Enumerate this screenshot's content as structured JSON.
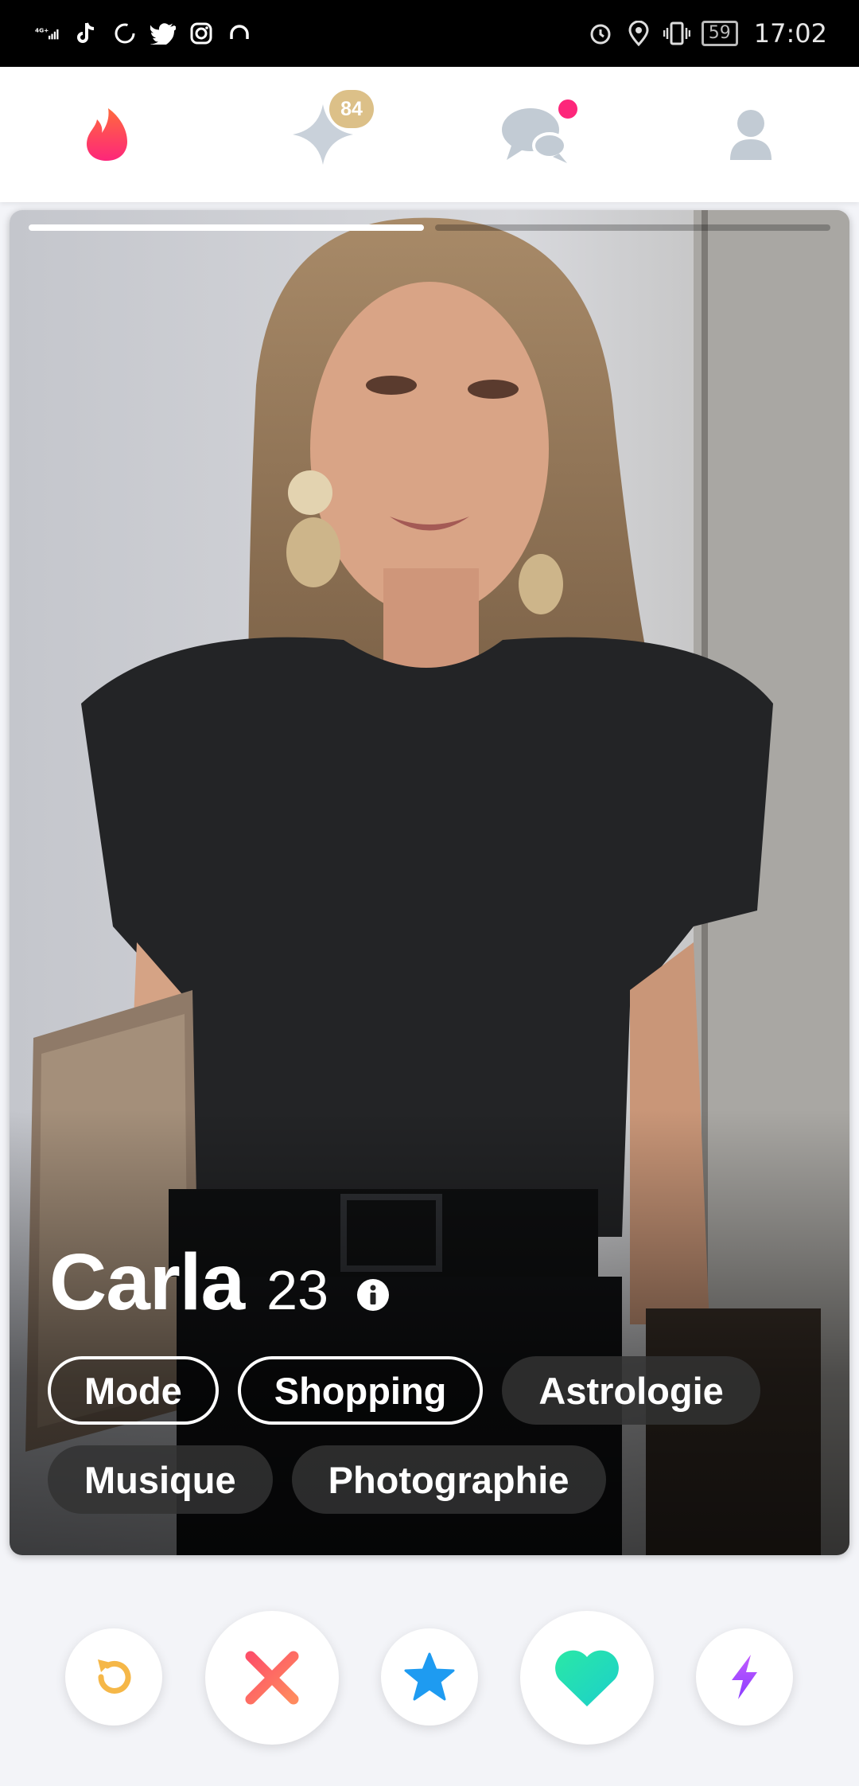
{
  "status_bar": {
    "network": "4G+",
    "battery": "59",
    "time": "17:02"
  },
  "nav": {
    "gold_badge": "84"
  },
  "profile": {
    "name": "Carla",
    "age": "23",
    "photo_progress": {
      "current": 1,
      "total": 2
    }
  },
  "interests_row1": [
    {
      "label": "Mode",
      "style": "outlined"
    },
    {
      "label": "Shopping",
      "style": "outlined"
    },
    {
      "label": "Astrologie",
      "style": "filled"
    }
  ],
  "interests_row2": [
    {
      "label": "Musique",
      "style": "filled"
    },
    {
      "label": "Photographie",
      "style": "filled"
    }
  ],
  "colors": {
    "brand_pink": "#fd267a",
    "gold": "#dcc088",
    "rewind": "#f5b748",
    "nope": "#fe4b6f",
    "super_like": "#1e9bf1",
    "like": "#26e0b0",
    "boost": "#a647ff"
  },
  "icons": [
    "flame-icon",
    "sparkle-icon",
    "chat-icon",
    "profile-icon",
    "info-icon",
    "rewind-icon",
    "nope-icon",
    "star-icon",
    "heart-icon",
    "bolt-icon"
  ]
}
